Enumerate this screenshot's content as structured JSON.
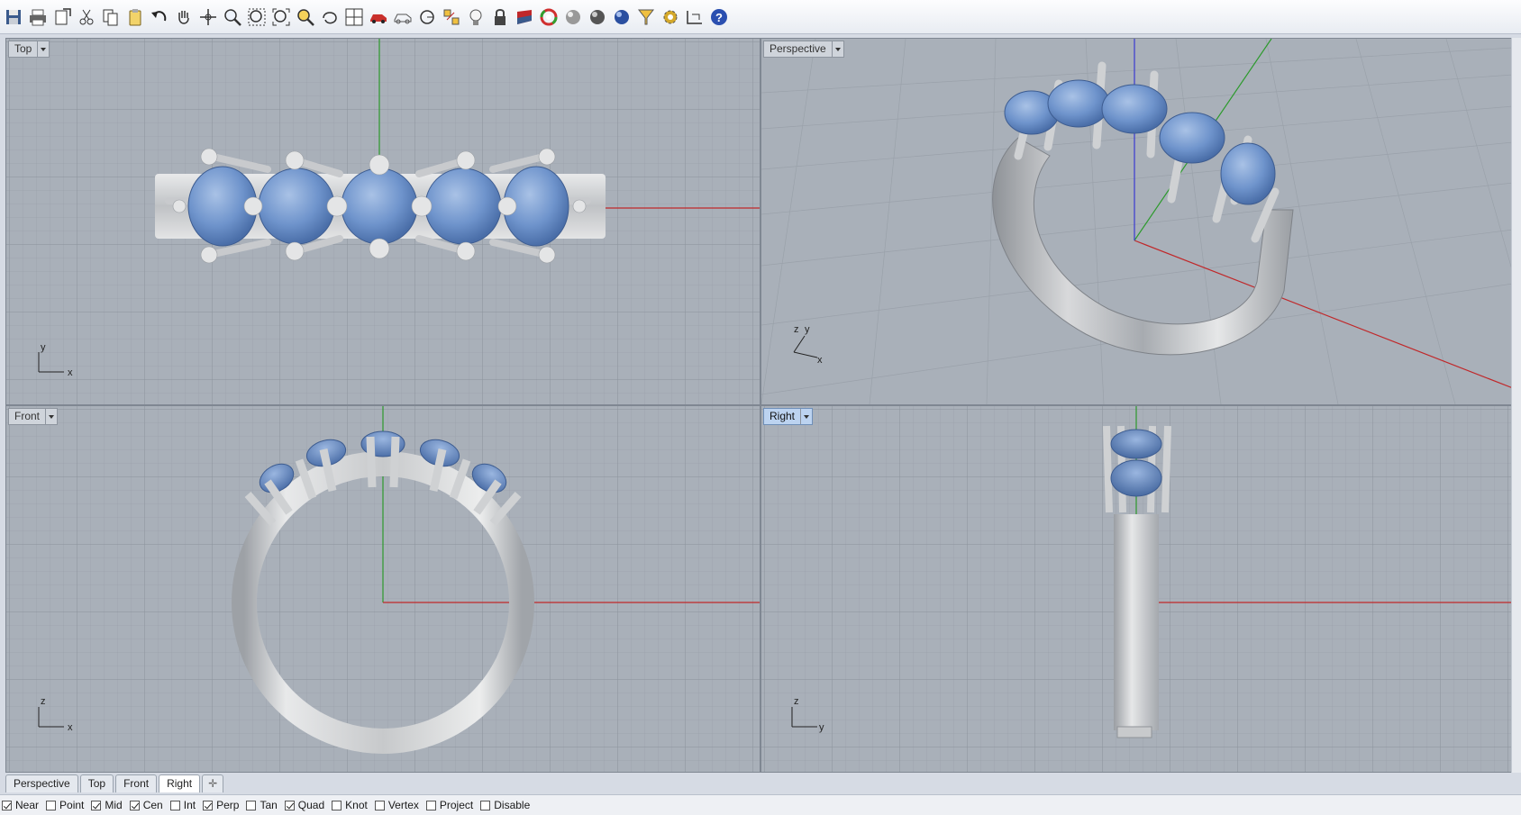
{
  "toolbar": {
    "icons": [
      "save-icon",
      "print-icon",
      "export-icon",
      "cut-icon",
      "copy-icon",
      "paste-icon",
      "undo-icon",
      "pan-icon",
      "rotate-view-icon",
      "zoom-icon",
      "zoom-window-icon",
      "zoom-extents-icon",
      "zoom-selected-icon",
      "rotate-icon",
      "four-viewports-icon",
      "car-shade-icon",
      "car-wire-icon",
      "circle-icon",
      "points-icon",
      "light-bulb-icon",
      "lock-icon",
      "material-icon",
      "color-wheel-icon",
      "sphere-grey-icon",
      "sphere-dark-icon",
      "sphere-blue-icon",
      "snap-filter-icon",
      "settings-gear-icon",
      "dimension-icon",
      "help-icon"
    ]
  },
  "viewports": {
    "top": {
      "label": "Top",
      "axis1": "y",
      "axis2": "x"
    },
    "perspective": {
      "label": "Perspective",
      "axis1": "z",
      "axis2": "y",
      "axis3": "x"
    },
    "front": {
      "label": "Front",
      "axis1": "z",
      "axis2": "x"
    },
    "right": {
      "label": "Right",
      "axis1": "z",
      "axis2": "y"
    }
  },
  "tabs": [
    "Perspective",
    "Top",
    "Front",
    "Right"
  ],
  "active_tab": "Right",
  "osnap": [
    {
      "label": "Near",
      "checked": true
    },
    {
      "label": "Point",
      "checked": false
    },
    {
      "label": "Mid",
      "checked": true
    },
    {
      "label": "Cen",
      "checked": true
    },
    {
      "label": "Int",
      "checked": false
    },
    {
      "label": "Perp",
      "checked": true
    },
    {
      "label": "Tan",
      "checked": false
    },
    {
      "label": "Quad",
      "checked": true
    },
    {
      "label": "Knot",
      "checked": false
    },
    {
      "label": "Vertex",
      "checked": false
    },
    {
      "label": "Project",
      "checked": false
    },
    {
      "label": "Disable",
      "checked": false
    }
  ],
  "colors": {
    "viewport_bg": "#a9b0b9",
    "grid_minor": "#9aa1aa",
    "grid_major": "#8a919b",
    "x_axis": "#c0282a",
    "y_axis": "#2c9a2c",
    "z_axis": "#3a3ad0",
    "gem": "#6f94cc",
    "metal": "#d2d4d6"
  }
}
